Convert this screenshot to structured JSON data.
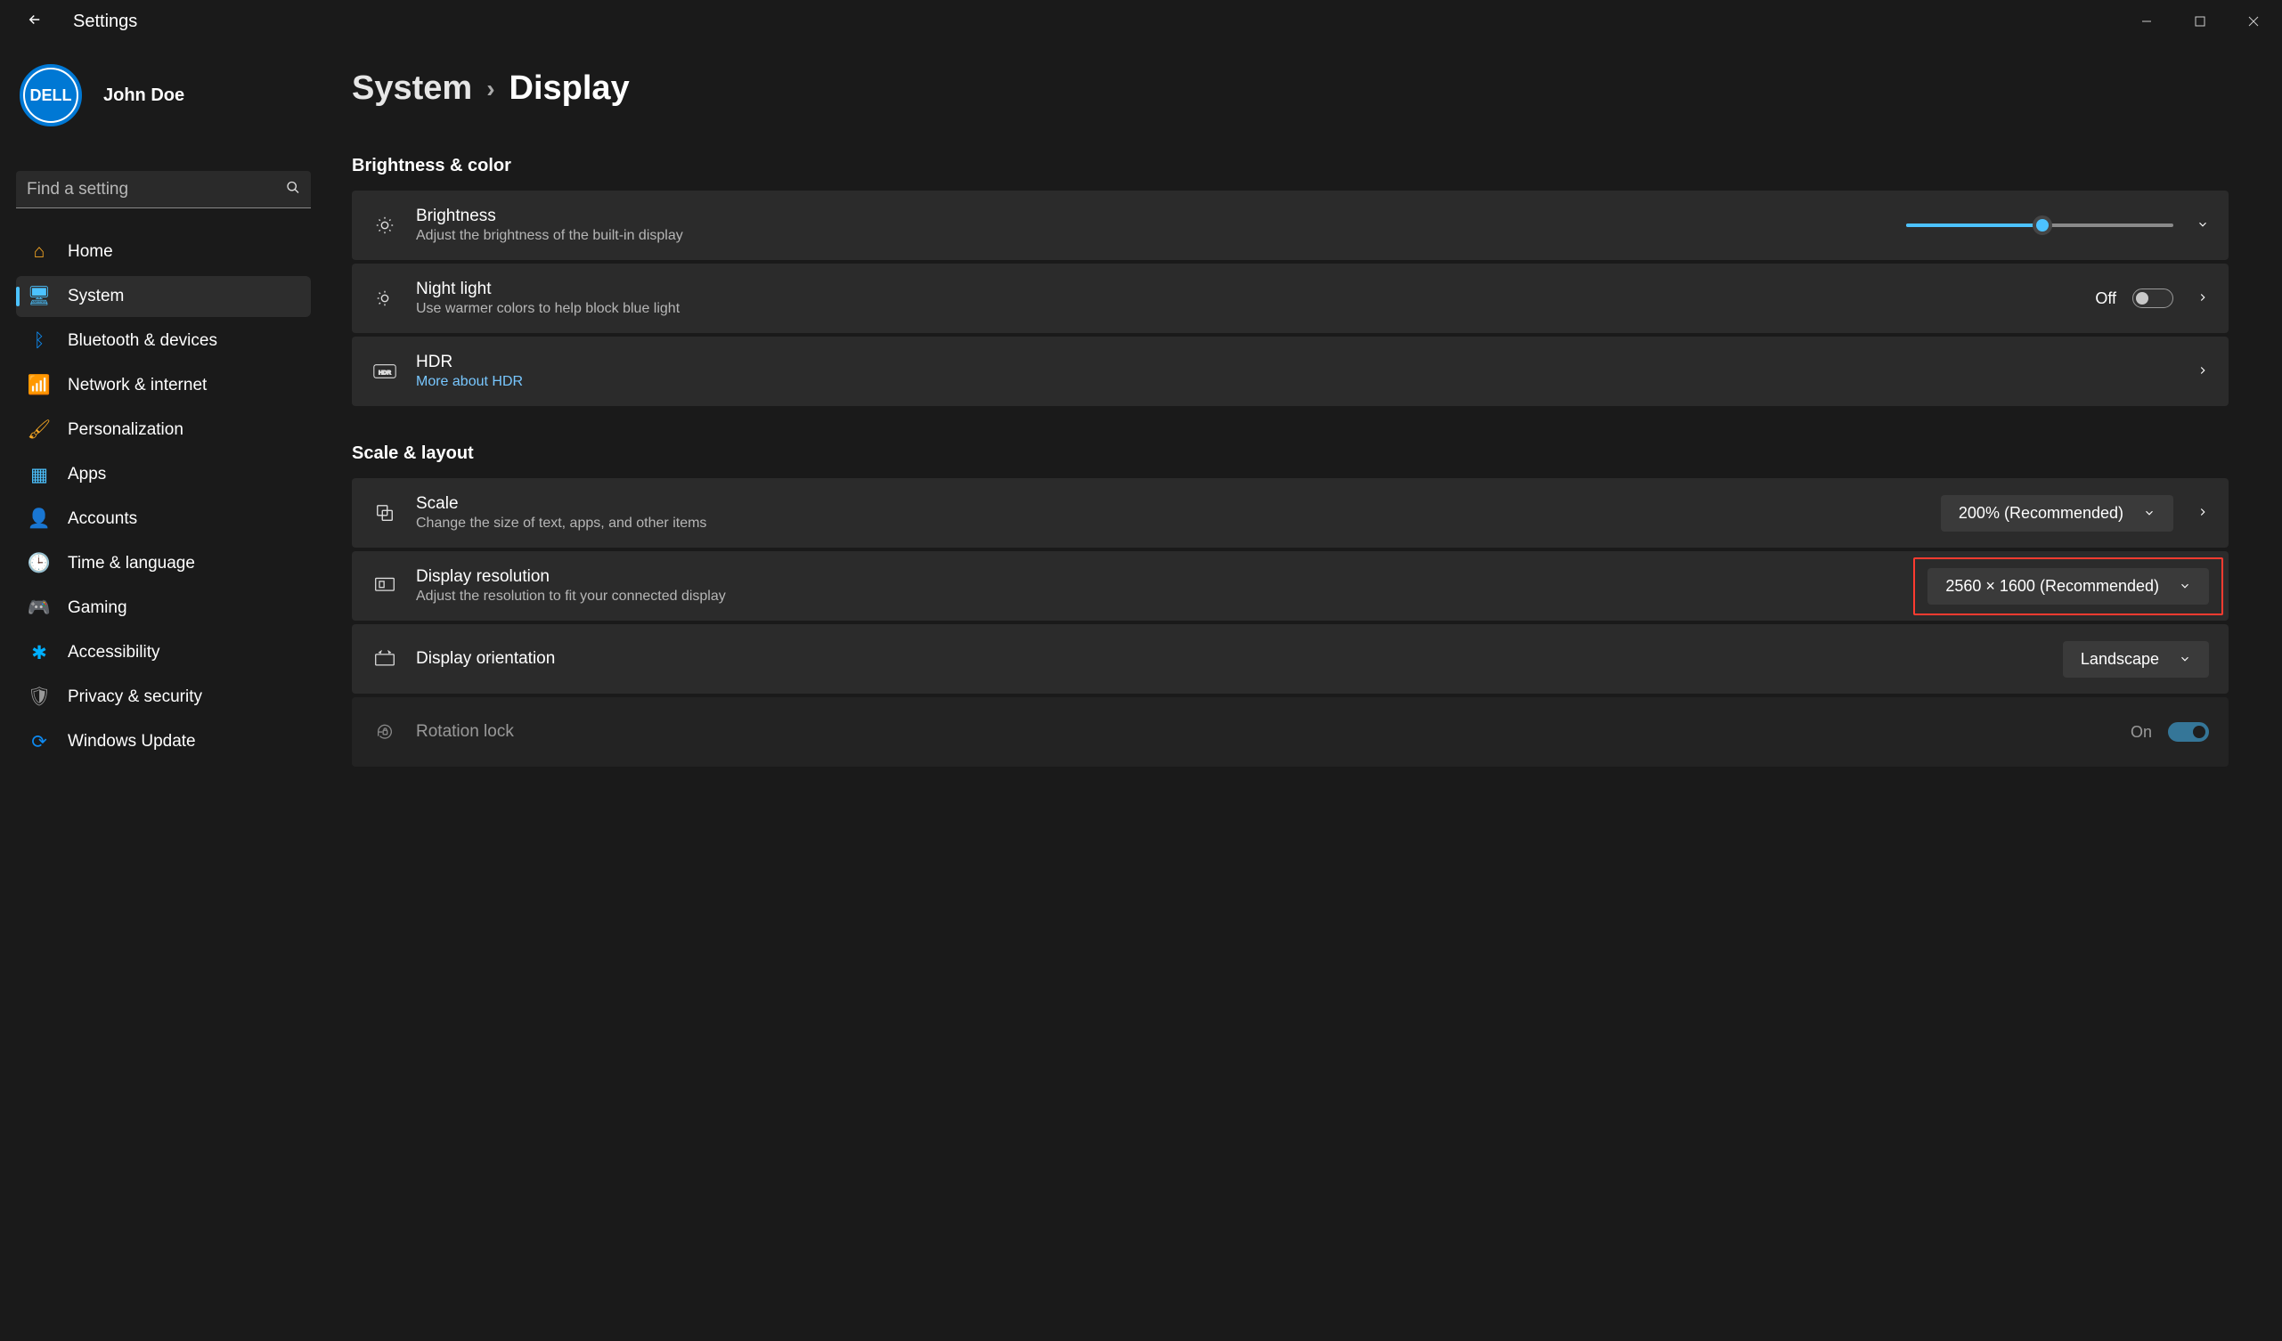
{
  "window": {
    "title": "Settings"
  },
  "user": {
    "name": "John Doe",
    "avatar_text": "DELL"
  },
  "search": {
    "placeholder": "Find a setting"
  },
  "nav": [
    {
      "id": "home",
      "label": "Home",
      "iconClass": "i-home",
      "glyph": "⌂"
    },
    {
      "id": "system",
      "label": "System",
      "iconClass": "i-system",
      "glyph": "🖥"
    },
    {
      "id": "bluetooth",
      "label": "Bluetooth & devices",
      "iconClass": "i-bt",
      "glyph": "ᛒ"
    },
    {
      "id": "network",
      "label": "Network & internet",
      "iconClass": "i-net",
      "glyph": "📶"
    },
    {
      "id": "personalization",
      "label": "Personalization",
      "iconClass": "i-pers",
      "glyph": "🖌"
    },
    {
      "id": "apps",
      "label": "Apps",
      "iconClass": "i-apps",
      "glyph": "▦"
    },
    {
      "id": "accounts",
      "label": "Accounts",
      "iconClass": "i-acct",
      "glyph": "👤"
    },
    {
      "id": "time",
      "label": "Time & language",
      "iconClass": "i-time",
      "glyph": "🕒"
    },
    {
      "id": "gaming",
      "label": "Gaming",
      "iconClass": "i-game",
      "glyph": "🎮"
    },
    {
      "id": "accessibility",
      "label": "Accessibility",
      "iconClass": "i-acc",
      "glyph": "✱"
    },
    {
      "id": "privacy",
      "label": "Privacy & security",
      "iconClass": "i-priv",
      "glyph": "🛡"
    },
    {
      "id": "update",
      "label": "Windows Update",
      "iconClass": "i-wu",
      "glyph": "⟳"
    }
  ],
  "nav_active": "system",
  "breadcrumb": {
    "parent": "System",
    "current": "Display"
  },
  "sections": {
    "bc": {
      "title": "Brightness & color",
      "brightness": {
        "title": "Brightness",
        "sub": "Adjust the brightness of the built-in display",
        "percent": 51
      },
      "nightlight": {
        "title": "Night light",
        "sub": "Use warmer colors to help block blue light",
        "state_label": "Off",
        "on": false
      },
      "hdr": {
        "title": "HDR",
        "link": "More about HDR"
      }
    },
    "sl": {
      "title": "Scale & layout",
      "scale": {
        "title": "Scale",
        "sub": "Change the size of text, apps, and other items",
        "value": "200% (Recommended)"
      },
      "resolution": {
        "title": "Display resolution",
        "sub": "Adjust the resolution to fit your connected display",
        "value": "2560 × 1600 (Recommended)",
        "highlighted": true
      },
      "orientation": {
        "title": "Display orientation",
        "value": "Landscape"
      },
      "rotationlock": {
        "title": "Rotation lock",
        "state_label": "On",
        "on": true,
        "disabled": true
      }
    }
  },
  "colors": {
    "accent": "#4cc2ff",
    "link": "#78c7ff",
    "annotation": "#ff3b30"
  }
}
